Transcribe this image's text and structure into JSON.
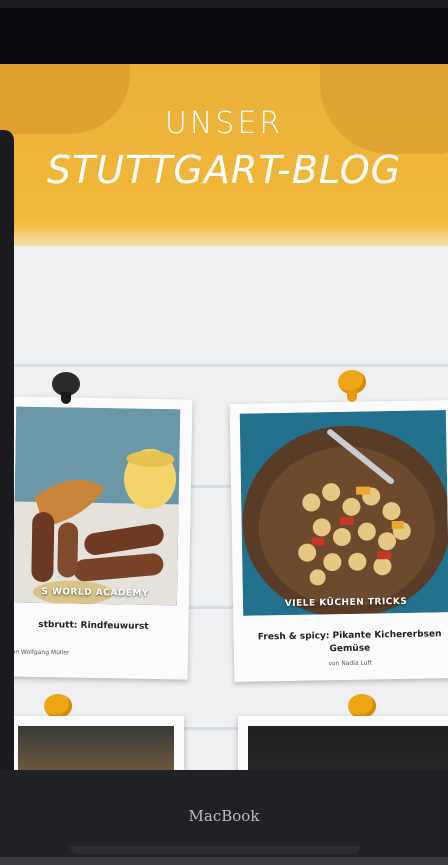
{
  "hero": {
    "subtitle": "UNSER",
    "title": "STUTTGART-BLOG"
  },
  "posts": [
    {
      "overlay": "S WORLD ACADEMY",
      "title": "stbrutt: Rindfeuwurst",
      "author": "von Wolfgang Müller"
    },
    {
      "overlay": "VIELE KÜCHEN TRICKS",
      "title": "Fresh & spicy: Pikante Kichererbsen Gemüse",
      "author": "von Nadia Luft"
    }
  ],
  "device": {
    "brand": "MacBook"
  },
  "colors": {
    "hero_yellow": "#f3bb3a",
    "pin_gold": "#f0a515",
    "pin_dark": "#2b2b2b"
  },
  "icons": [
    "pin-icon"
  ]
}
